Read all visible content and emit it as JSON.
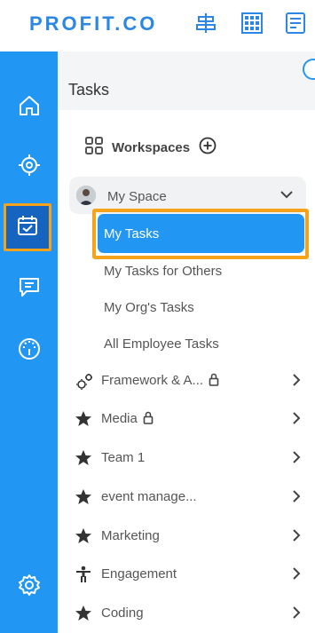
{
  "app": {
    "logo_text": "PROFIT.CO",
    "brand_color": "#2b86e4",
    "rail_color": "#2196f3",
    "highlight_color": "#f7a21b"
  },
  "top_icons": [
    "align-icon",
    "grid-icon",
    "report-icon"
  ],
  "rail": {
    "items": [
      "home-icon",
      "target-icon",
      "calendar-check-icon",
      "chat-icon",
      "gauge-icon"
    ],
    "bottom": "settings-gear-icon"
  },
  "page": {
    "title": "Tasks"
  },
  "workspaces": {
    "label": "Workspaces"
  },
  "my_space": {
    "label": "My Space",
    "items": [
      "My Tasks",
      "My Tasks for Others",
      "My Org's Tasks",
      "All Employee Tasks"
    ],
    "active": "My Tasks"
  },
  "spaces": [
    {
      "label": "Framework & A...",
      "icon": "gears-icon",
      "locked": true
    },
    {
      "label": "Media",
      "icon": "star-icon",
      "locked": true
    },
    {
      "label": "Team 1",
      "icon": "star-icon",
      "locked": false
    },
    {
      "label": "event manage...",
      "icon": "star-icon",
      "locked": false
    },
    {
      "label": "Marketing",
      "icon": "star-icon",
      "locked": false
    },
    {
      "label": "Engagement",
      "icon": "person-icon",
      "locked": false
    },
    {
      "label": "Coding",
      "icon": "star-icon",
      "locked": false
    }
  ]
}
